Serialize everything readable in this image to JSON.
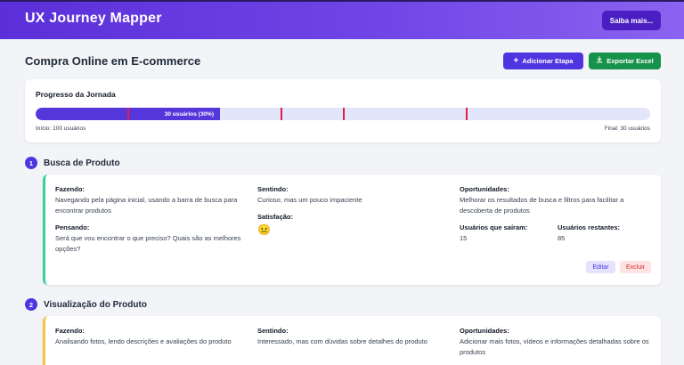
{
  "header": {
    "title": "UX Journey Mapper",
    "info_button": "Saiba mais..."
  },
  "page": {
    "title": "Compra Online em E-commerce",
    "add_button": "Adicionar Etapa",
    "export_button": "Exportar Excel"
  },
  "progress": {
    "title": "Progresso da Jornada",
    "bar_label": "30 usuários (30%)",
    "fraction": 0.3,
    "start_label": "Início: 100 usuários",
    "end_label": "Final: 30 usuários",
    "accent_color": "#5536db",
    "marker_color": "#e11d48"
  },
  "stages": [
    {
      "number": "1",
      "title": "Busca de Produto",
      "doing_label": "Fazendo:",
      "doing": "Navegando pela página inicial, usando a barra de busca para encontrar produtos",
      "thinking_label": "Pensando:",
      "thinking": "Será que vou encontrar o que preciso? Quais são as melhores opções?",
      "feeling_label": "Sentindo:",
      "feeling": "Curioso, mas um pouco impaciente",
      "satisfaction_label": "Satisfação:",
      "satisfaction_emoji": "😐",
      "opportunities_label": "Oportunidades:",
      "opportunities": "Melhorar os resultados de busca e filtros para facilitar a descoberta de produtos",
      "left_label": "Usuários que saíram:",
      "left_value": "15",
      "remaining_label": "Usuários restantes:",
      "remaining_value": "85",
      "edit": "Editar",
      "delete": "Excluir"
    },
    {
      "number": "2",
      "title": "Visualização do Produto",
      "doing_label": "Fazendo:",
      "doing": "Analisando fotos, lendo descrições e avaliações do produto",
      "feeling_label": "Sentindo:",
      "feeling": "Interessado, mas com dúvidas sobre detalhes do produto",
      "opportunities_label": "Oportunidades:",
      "opportunities": "Adicionar mais fotos, vídeos e informações detalhadas sobre os produtos"
    }
  ]
}
